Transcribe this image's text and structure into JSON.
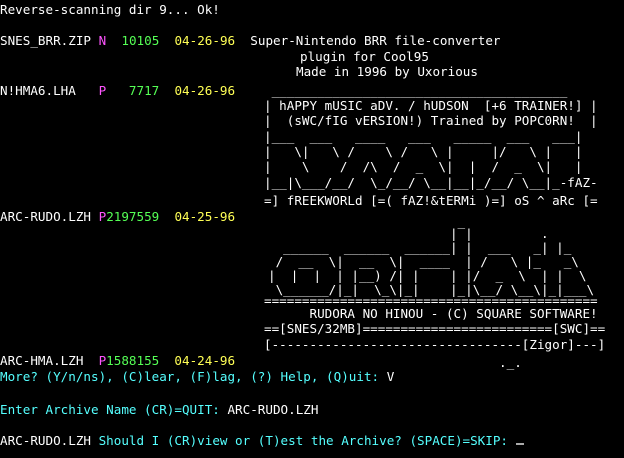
{
  "status_line": "Reverse-scanning dir 9... Ok!",
  "files": [
    {
      "name": "SNES_BRR.ZIP",
      "flag": "N",
      "size": "10105",
      "date": "04-26-96",
      "description": [
        "Super-Nintendo BRR file-converter",
        "plugin for Cool95",
        "Made in 1996 by Uxorious"
      ]
    },
    {
      "name": "N!HMA6.LHA",
      "flag": "P",
      "size": "7717",
      "date": "04-26-96",
      "description": [
        " _______________________________________",
        "| hAPPY mUSIC aDV. / hUDSON  [+6 TRAINER!] |",
        "|  (sWC/fIG vERSION!) Trained by POPC0RN!  |",
        "|___  ___   ____   ___   _____  ___   ___|",
        "|   \\|   \\ /    \\ /   \\ |     |/   \\ |   |",
        "|    \\    /  /\\  /  _  \\|  |  /  _  \\|   |",
        "|__|\\___/__/  \\_/__/ \\__|__|_/__/ \\__|_-fAZ-",
        "=] fREEKWORLd [=( fAZ!&tERMi )=] oS ^ aRc [="
      ]
    },
    {
      "name": "ARC-RUDO.LZH",
      "flag": "P",
      "size": "2197559",
      "date": "04-25-96",
      "description": [
        "                         _",
        "                        | |         .",
        "  ______  ______  ______| |  ___   _| |_",
        " /  __  \\|  __  \\|  ____  | /   \\ |_   _\\",
        "|  |  |  | |__) /| |    | |/  _  \\  | |  \\",
        " \\______/|_|  \\_\\|_|    |_|\\__/ \\__\\|_|___\\",
        "============================================",
        "      RUDORA NO HINOU - (C) SQUARE SOFTWARE!",
        "==[SNES/32MB]=========================[SWC]==",
        "[---------------------------------[Zigor]---]"
      ]
    },
    {
      "name": "ARC-HMA.LZH",
      "flag": "P",
      "size": "1588155",
      "date": "04-24-96",
      "description": [
        "                               ._."
      ]
    }
  ],
  "more_prompt": {
    "text": "More? (Y/n/ns), (C)lear, (F)lag, (?) Help, (Q)uit: ",
    "answer": "V"
  },
  "archive_prompt": {
    "label": "Enter Archive Name (CR)=QUIT: ",
    "value": "ARC-RUDO.LZH"
  },
  "action_prompt": {
    "archive": "ARC-RUDO.LZH",
    "text": " Should I (CR)view or (T)est the Archive? (SPACE)=SKIP: "
  },
  "colors": {
    "background": "#000000",
    "filename": "#ffffff",
    "flag": "#ff55ff",
    "size": "#55ff55",
    "date": "#ffff55",
    "prompt": "#55ffff"
  }
}
